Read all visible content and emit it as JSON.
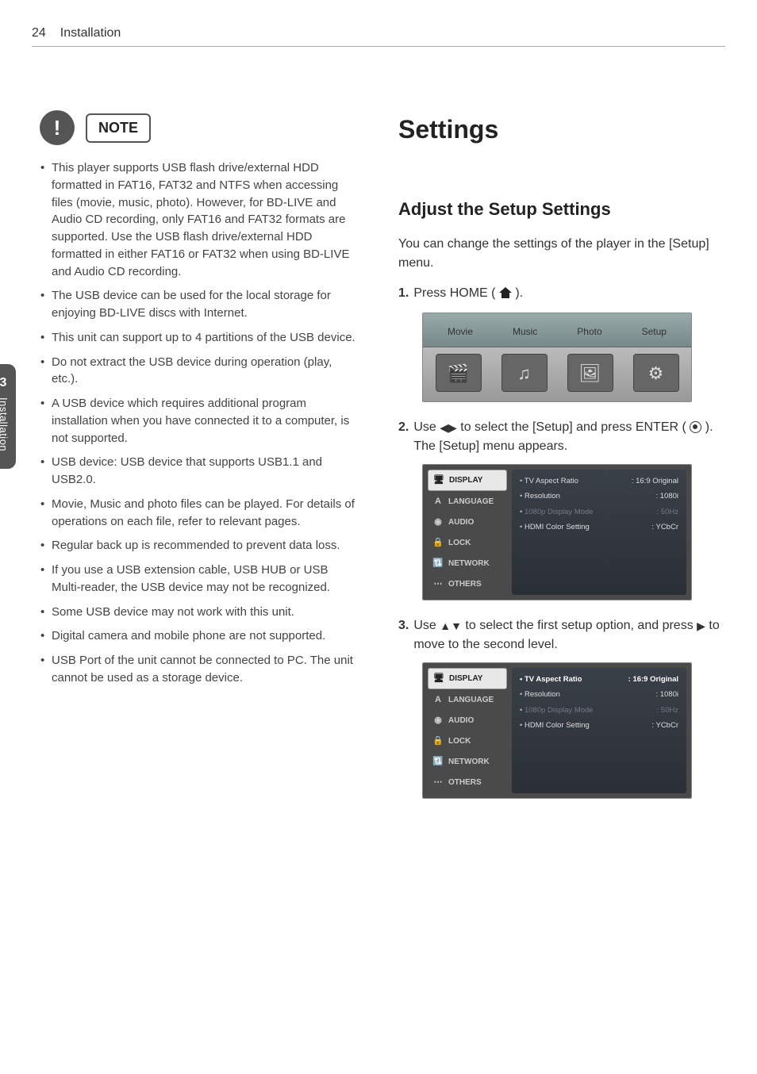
{
  "page": {
    "number": "24",
    "section": "Installation"
  },
  "sideTab": {
    "num": "3",
    "text": "Installation"
  },
  "note": {
    "label": "NOTE",
    "items": [
      "This player supports USB flash drive/external HDD formatted in FAT16, FAT32 and NTFS when accessing files (movie, music, photo). However, for BD-LIVE and Audio CD recording, only FAT16 and FAT32 formats are supported. Use the USB flash drive/external HDD formatted in either FAT16 or FAT32 when using BD-LIVE and Audio CD recording.",
      "The USB device can be used for the local storage for enjoying BD-LIVE discs with Internet.",
      "This unit can support up to 4 partitions of the USB device.",
      "Do not extract the USB device during operation (play, etc.).",
      "A USB device which requires additional program installation when you have connected it to a computer, is not supported.",
      "USB device: USB device that supports USB1.1 and USB2.0.",
      "Movie, Music and photo files can be played. For details of operations on each file, refer to relevant pages.",
      "Regular back up is recommended to prevent data loss.",
      "If you use a USB extension cable, USB HUB or USB Multi-reader, the USB device may not be recognized.",
      "Some USB device may not work with this unit.",
      "Digital camera and mobile phone are not supported.",
      "USB Port of the unit cannot be connected to PC. The unit cannot be used as a storage device."
    ]
  },
  "right": {
    "title": "Settings",
    "subhead": "Adjust the Setup Settings",
    "intro": "You can change the settings of the player in the [Setup] menu.",
    "step1_pre": "Press HOME (",
    "step1_post": ").",
    "step2_pre": "Use ",
    "step2_mid": " to select the [Setup] and press ENTER (",
    "step2_post": "). The [Setup] menu appears.",
    "step3_pre": "Use ",
    "step3_mid": " to select the first setup option, and press ",
    "step3_post": " to move to the second level."
  },
  "home": {
    "labels": [
      "Movie",
      "Music",
      "Photo",
      "Setup"
    ],
    "tileIcons": [
      "🎬",
      "♫",
      "🖼",
      "⚙"
    ]
  },
  "setupSidebar": [
    "DISPLAY",
    "LANGUAGE",
    "AUDIO",
    "LOCK",
    "NETWORK",
    "OTHERS"
  ],
  "setupSidebarIcons": [
    "🖥",
    "A",
    "◉",
    "🔒",
    "🔃",
    "⋯"
  ],
  "setupOptions": [
    {
      "label": "TV Aspect Ratio",
      "value": ": 16:9 Original",
      "dim": false,
      "hl": false
    },
    {
      "label": "Resolution",
      "value": ": 1080i",
      "dim": false,
      "hl": false
    },
    {
      "label": "1080p Display Mode",
      "value": ": 50Hz",
      "dim": true,
      "hl": false
    },
    {
      "label": "HDMI Color Setting",
      "value": ": YCbCr",
      "dim": false,
      "hl": false
    }
  ],
  "setupOptions2": [
    {
      "label": "TV Aspect Ratio",
      "value": ": 16:9 Original",
      "dim": false,
      "hl": true
    },
    {
      "label": "Resolution",
      "value": ": 1080i",
      "dim": false,
      "hl": false
    },
    {
      "label": "1080p Display Mode",
      "value": ": 50Hz",
      "dim": true,
      "hl": false
    },
    {
      "label": "HDMI Color Setting",
      "value": ": YCbCr",
      "dim": false,
      "hl": false
    }
  ]
}
